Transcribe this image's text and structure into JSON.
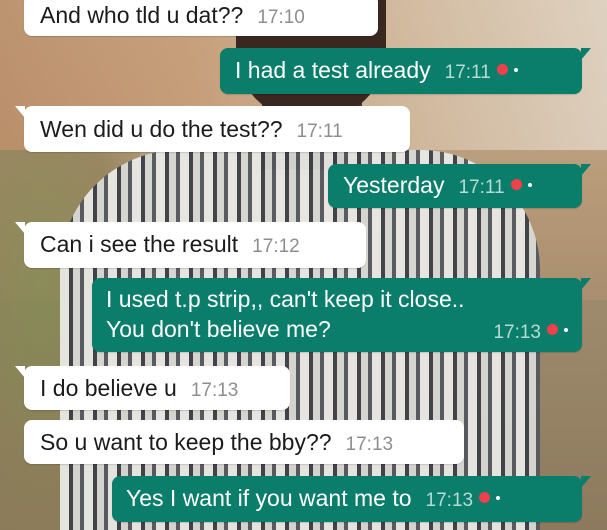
{
  "colors": {
    "incoming_bubble": "#ffffff",
    "outgoing_bubble": "#0a7d6b",
    "incoming_time": "#8e8e8e",
    "outgoing_time": "#b7dcd4",
    "tick": "#f0404a"
  },
  "messages": [
    {
      "direction": "in",
      "text": "And who tld u dat??",
      "time": "17:10"
    },
    {
      "direction": "out",
      "text": "I had a test already",
      "time": "17:11",
      "status_icon": "read-receipt-icon"
    },
    {
      "direction": "in",
      "text": "Wen did u do the test??",
      "time": "17:11"
    },
    {
      "direction": "out",
      "text": "Yesterday",
      "time": "17:11",
      "status_icon": "read-receipt-icon"
    },
    {
      "direction": "in",
      "text": "Can i see the result",
      "time": "17:12"
    },
    {
      "direction": "out",
      "lines": [
        "I used t.p strip,, can't keep it close..",
        "You don't believe me?"
      ],
      "time": "17:13",
      "status_icon": "read-receipt-icon"
    },
    {
      "direction": "in",
      "text": "I do believe u",
      "time": "17:13"
    },
    {
      "direction": "in",
      "text": "So u want to keep the bby??",
      "time": "17:13"
    },
    {
      "direction": "out",
      "text": "Yes I want if you want me to",
      "time": "17:13",
      "status_icon": "read-receipt-icon"
    }
  ]
}
